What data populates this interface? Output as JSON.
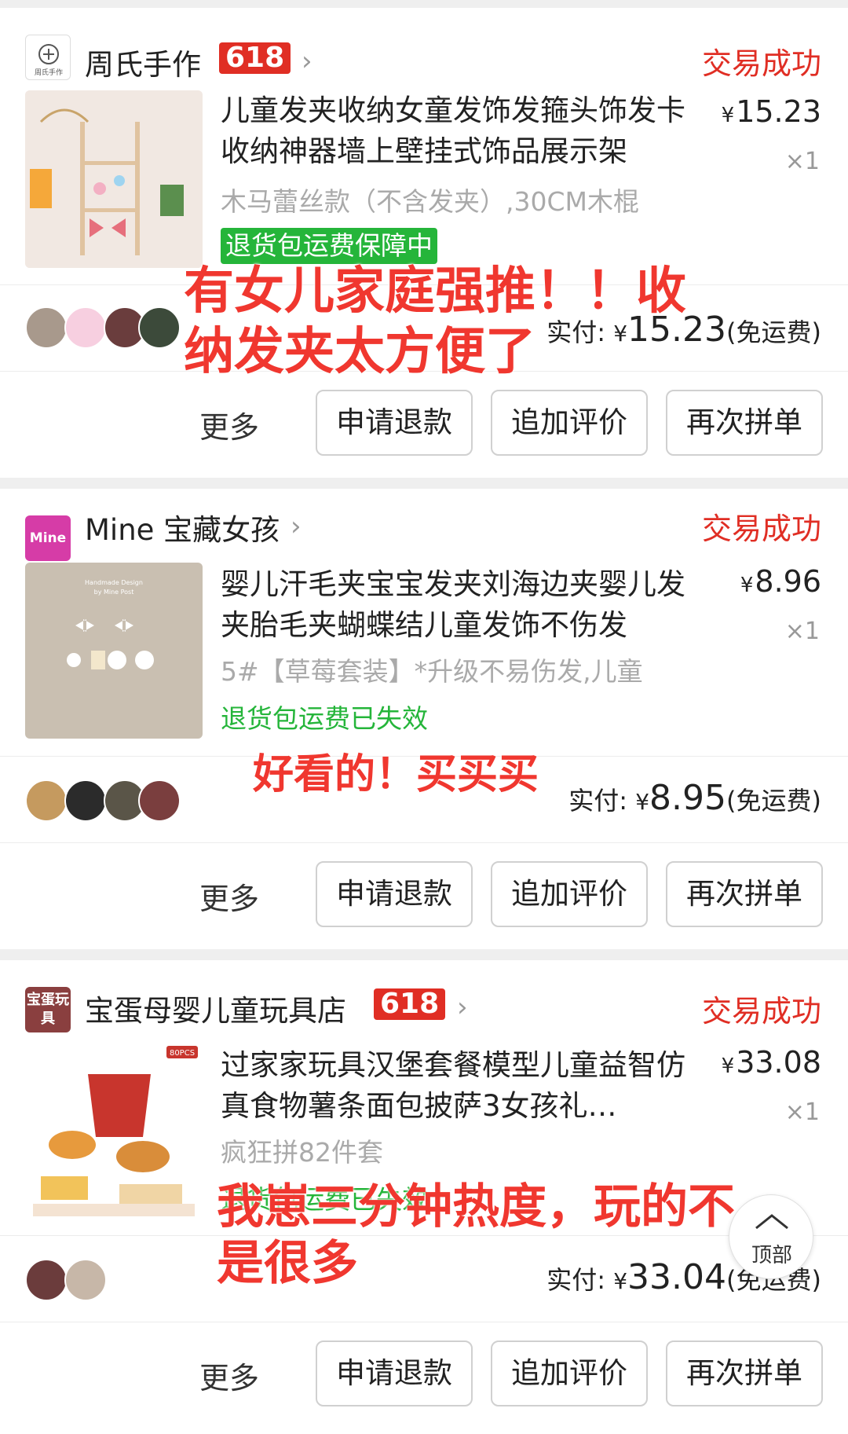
{
  "orders": [
    {
      "shop_name": "周氏手作",
      "badge": "618",
      "status": "交易成功",
      "logo_text": "周氏手作",
      "title": "儿童发夹收纳女童发饰发箍头饰发卡收纳神器墙上壁挂式饰品展示架",
      "spec": "木马蕾丝款（不含发夹）,30CM木棍",
      "guarantee": "退货包运费保障中",
      "price": "15.23",
      "currency": "¥",
      "qty": "×1",
      "paid_label": "实付:",
      "paid_amount": "15.23",
      "shipping": "(免运费)",
      "overlay_text": "有女儿家庭强推！！收纳发夹太方便了"
    },
    {
      "shop_name": "Mine 宝藏女孩",
      "badge": "",
      "status": "交易成功",
      "logo_text": "Mine",
      "title": "婴儿汗毛夹宝宝发夹刘海边夹婴儿发夹胎毛夹蝴蝶结儿童发饰不伤发",
      "spec": "5#【草莓套装】*升级不易伤发,儿童",
      "guarantee": "退货包运费已失效",
      "price": "8.96",
      "currency": "¥",
      "qty": "×1",
      "paid_label": "实付:",
      "paid_amount": "8.95",
      "shipping": "(免运费)",
      "overlay_text": "好看的！买买买"
    },
    {
      "shop_name": "宝蛋母婴儿童玩具店",
      "badge": "618",
      "status": "交易成功",
      "logo_text": "宝蛋玩具",
      "title": "过家家玩具汉堡套餐模型儿童益智仿真食物薯条面包披萨3女孩礼…",
      "spec": "疯狂拼82件套",
      "guarantee": "退货包运费已失效",
      "price": "33.08",
      "currency": "¥",
      "qty": "×1",
      "paid_label": "实付:",
      "paid_amount": "33.04",
      "shipping": "(免运费)",
      "overlay_text": "我崽三分钟热度，玩的不是很多"
    }
  ],
  "actions": {
    "more": "更多",
    "refund": "申请退款",
    "review": "追加评价",
    "reorder": "再次拼单"
  },
  "back_to_top": "顶部",
  "colors": {
    "accent_red": "#e02e24",
    "green": "#25b53a",
    "overlay_red": "#f0372f"
  }
}
